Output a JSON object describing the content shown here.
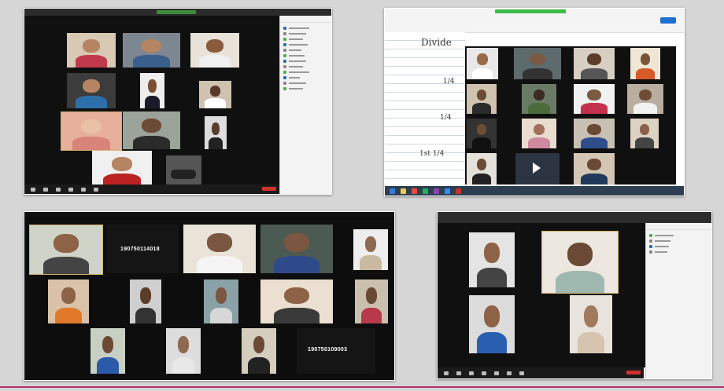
{
  "screens": {
    "top_left": {
      "app": "zoom-gallery",
      "window": "Participants"
    },
    "top_right": {
      "app": "zoom-over-whiteboard",
      "notes": [
        "Divide",
        "1/4",
        "1/4",
        "1st 1/4"
      ],
      "status_color": "#3dbb4a"
    },
    "bottom_left": {
      "app": "zoom-gallery",
      "ids": [
        "190750114018",
        "190750109003"
      ]
    },
    "bottom_right": {
      "app": "zoom-gallery",
      "window": "Participants"
    }
  },
  "colors": {
    "accent_rule": "#b0306a",
    "zoom_end": "#d32f2f"
  }
}
